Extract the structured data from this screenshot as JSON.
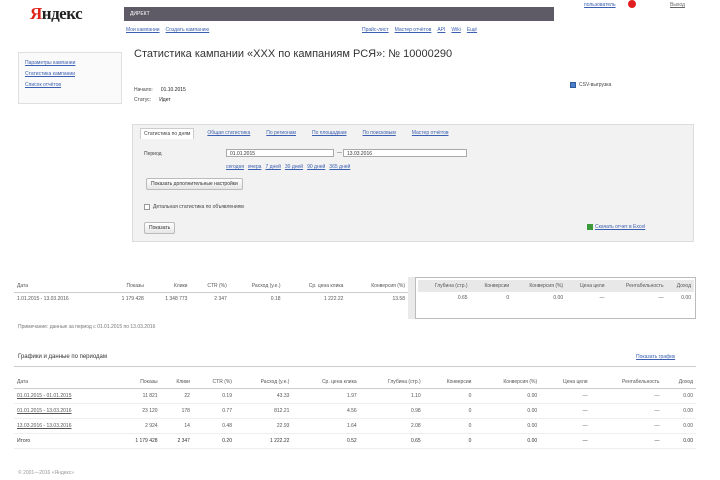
{
  "header": {
    "logo_first": "Я",
    "logo_rest": "ндекс",
    "bar_title": "ДИРЕКТ",
    "nav": [
      "Мои кампании",
      "Создать кампанию",
      "Прайс-лист",
      "Мастер отчётов",
      "API",
      "Wiki",
      "Ещё"
    ],
    "user_link": "пользователь",
    "exit_link": "Выход"
  },
  "sidebar": {
    "items": [
      "Параметры кампании",
      "Статистика кампании",
      "Список отчётов"
    ]
  },
  "page": {
    "title": "Статистика кампании «ХХХ по кампаниям РСЯ»: № 10000290",
    "meta": [
      {
        "label": "Начало:",
        "value": "01.10.2015"
      },
      {
        "label": "Статус:",
        "value": "Идет"
      }
    ],
    "csv_label": "CSV-выгрузка"
  },
  "filter": {
    "tabs": [
      "Статистика по дням",
      "Общая статистика",
      "По регионам",
      "По площадкам",
      "По поисковым",
      "Мастер отчётов"
    ],
    "active_tab": 0,
    "period_label": "Период",
    "date_from": "01.01.2015",
    "date_to": "13.03.2016",
    "quick_links": [
      "сегодня",
      "вчера",
      "7 дней",
      "30 дней",
      "90 дней",
      "365 дней"
    ],
    "extra_button": "Показать дополнительные настройки",
    "checkbox_label": "Детальная статистика по объявлениям",
    "submit_button": "Показать",
    "export_link": "Скачать отчет в Excel"
  },
  "summary": {
    "headers": [
      "Дата",
      "Показы",
      "Клики",
      "CTR (%)",
      "Расход (у.е.)",
      "Ср. цена клика",
      "Глубина",
      "Конверсия (%)"
    ],
    "row": [
      "1.01.2015 - 13.03.2016",
      "1 179 428",
      "1 348 773",
      "2 347",
      "0.18",
      "1 222.22",
      "13.58"
    ],
    "right_headers": [
      "Глубина (стр.)",
      "Конверсии",
      "Конверсия (%)",
      "Цена цели",
      "Рентабельность",
      "Доход"
    ],
    "right_row": [
      "0.65",
      "0",
      "0.00",
      "—",
      "—",
      "0.00"
    ],
    "note": "Примечание: данные за период с 01.01.2015 по 13.03.2016"
  },
  "details": {
    "title": "Графики и данные по периодам",
    "link": "Показать график",
    "headers": [
      "Дата",
      "Показы",
      "Клики",
      "CTR (%)",
      "Расход (у.е.)",
      "Ср. цена клика",
      "Глубина (стр.)",
      "Конверсии",
      "Конверсия (%)",
      "Цена цели",
      "Рентабельность",
      "Доход"
    ],
    "rows": [
      [
        "01.01.2015 - 01.01.2015",
        "11 821",
        "22",
        "0.19",
        "43.33",
        "1.97",
        "1.10",
        "0",
        "0.00",
        "—",
        "—",
        "0.00"
      ],
      [
        "01.01.2015 - 13.03.2016",
        "23 120",
        "178",
        "0.77",
        "812.21",
        "4.56",
        "0.98",
        "0",
        "0.00",
        "—",
        "—",
        "0.00"
      ],
      [
        "13.03.2016 - 13.03.2016",
        "2 924",
        "14",
        "0.48",
        "22.93",
        "1.64",
        "2.08",
        "0",
        "0.00",
        "—",
        "—",
        "0.00"
      ]
    ],
    "total": [
      "Итого",
      "1 179 428",
      "2 347",
      "0.20",
      "1 222.22",
      "0.52",
      "0.65",
      "0",
      "0.00",
      "—",
      "—",
      "0.00"
    ]
  },
  "footer": {
    "text": "© 2001—2016 «Яндекс»"
  },
  "colors": {
    "accent_red": "#e0241a",
    "header_bar": "#5e5a66",
    "link_blue": "#3a5fb0"
  }
}
